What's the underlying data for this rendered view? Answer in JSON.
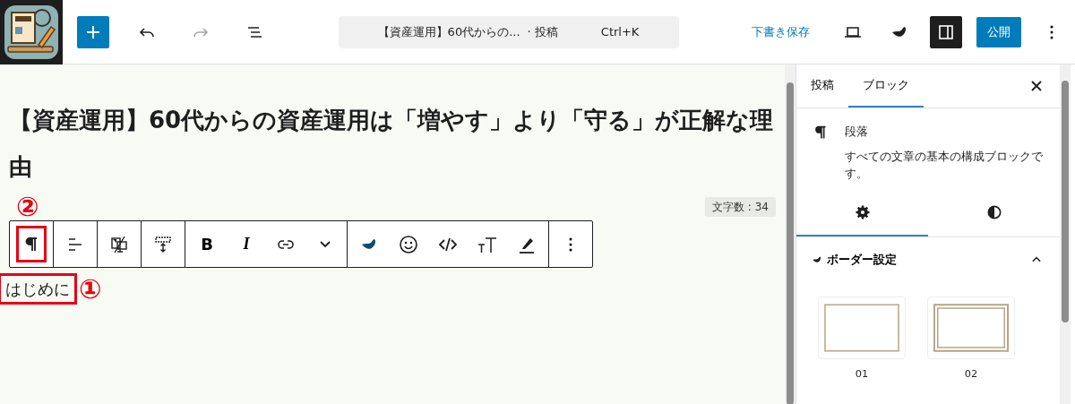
{
  "header": {
    "tools": [
      {
        "kind": "inserter",
        "disabled": false
      },
      {
        "kind": "undo",
        "disabled": false
      },
      {
        "kind": "redo",
        "disabled": true
      },
      {
        "kind": "list_view",
        "disabled": false
      }
    ],
    "document_bar": {
      "title": "【資産運用】60代からの...",
      "type": "· 投稿",
      "shortcut": "Ctrl+K"
    },
    "save_draft": "下書き保存",
    "actions": [
      {
        "kind": "preview",
        "selected": false
      },
      {
        "kind": "plugin",
        "selected": false
      },
      {
        "kind": "sidebar",
        "selected": true
      }
    ],
    "publish": "公開"
  },
  "editor": {
    "post_title": "【資産運用】60代からの資産運用は「増やす」より「守る」が正解な理由",
    "word_count": "文字数 : 34",
    "toolbar": [
      [
        {
          "kind": "paragraph",
          "highlighted": true
        }
      ],
      [
        {
          "kind": "align",
          "highlighted": false
        }
      ],
      [
        {
          "kind": "device",
          "highlighted": false
        }
      ],
      [
        {
          "kind": "spacing",
          "highlighted": false
        }
      ],
      [
        {
          "kind": "text",
          "text": "B",
          "highlighted": false
        },
        {
          "kind": "italic",
          "text": "I",
          "highlighted": false
        },
        {
          "kind": "link",
          "highlighted": false
        },
        {
          "kind": "chevron",
          "highlighted": false
        }
      ],
      [
        {
          "kind": "plugin",
          "highlighted": false
        },
        {
          "kind": "emoji",
          "highlighted": false
        },
        {
          "kind": "code",
          "highlighted": false
        },
        {
          "kind": "fontsize",
          "highlighted": false
        },
        {
          "kind": "highlighter",
          "highlighted": false
        }
      ],
      [
        {
          "kind": "more",
          "highlighted": false
        }
      ]
    ],
    "paragraph": {
      "text": "はじめに",
      "highlighted": true
    },
    "annotations": [
      {
        "label": "②"
      },
      {
        "label": "①"
      }
    ]
  },
  "sidebar": {
    "tabs": [
      {
        "label": "投稿",
        "selected": false
      },
      {
        "label": "ブロック",
        "selected": true
      }
    ],
    "block": {
      "name": "段落",
      "description": "すべての文章の基本の構成ブロックです。"
    },
    "subtabs": [
      {
        "kind": "settings",
        "selected": true
      },
      {
        "kind": "styles",
        "selected": false
      }
    ],
    "panel": {
      "title": "ボーダー設定",
      "expanded": true,
      "styles": [
        {
          "label": "01",
          "kind": "single"
        },
        {
          "label": "02",
          "kind": "double"
        }
      ]
    }
  }
}
